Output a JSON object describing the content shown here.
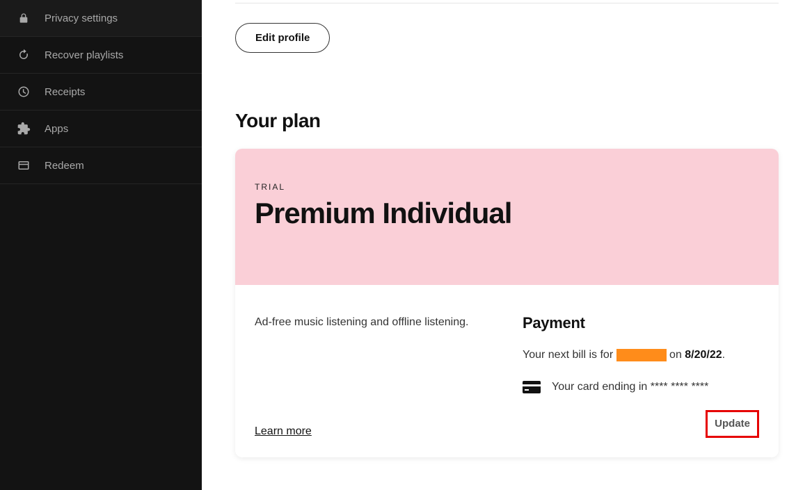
{
  "sidebar": {
    "items": [
      {
        "label": "Privacy settings"
      },
      {
        "label": "Recover playlists"
      },
      {
        "label": "Receipts"
      },
      {
        "label": "Apps"
      },
      {
        "label": "Redeem"
      }
    ]
  },
  "profile": {
    "edit_label": "Edit profile"
  },
  "plan_section": {
    "heading": "Your plan"
  },
  "plan": {
    "badge": "TRIAL",
    "name": "Premium Individual",
    "description": "Ad-free music listening and offline listening.",
    "learn_more_label": "Learn more"
  },
  "payment": {
    "title": "Payment",
    "next_bill_prefix": "Your next bill is for ",
    "next_bill_on": " on ",
    "next_bill_date": "8/20/22",
    "next_bill_period": ".",
    "card_prefix": "Your card ending in ",
    "card_masked": "**** **** ****",
    "update_label": "Update"
  }
}
